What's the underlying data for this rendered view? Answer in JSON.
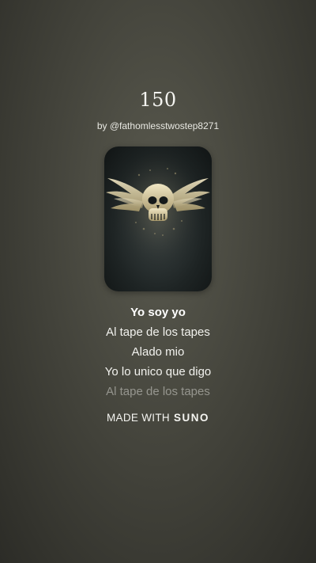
{
  "song": {
    "title": "150",
    "artist_line": "by @fathomlesstwostep8271"
  },
  "cover": {
    "icon": "winged-skull-icon",
    "accent_color": "#c9b98a"
  },
  "lyrics": [
    "Yo soy yo",
    "Al tape de los tapes",
    "Alado mio",
    "Yo lo unico que digo",
    "Al tape de los tapes"
  ],
  "footer": {
    "made_with": "MADE WITH",
    "brand": "SUNO"
  }
}
